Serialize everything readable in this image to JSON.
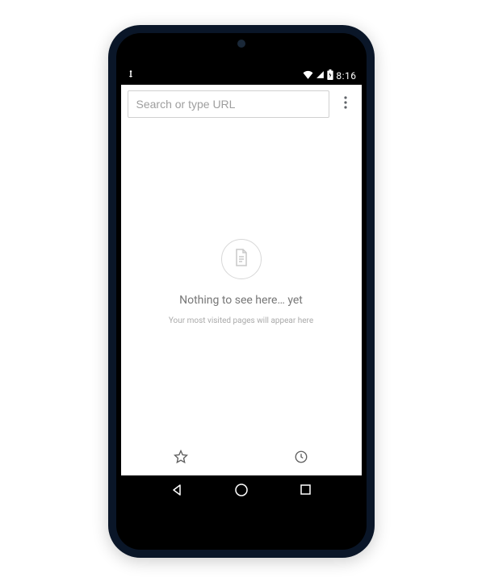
{
  "status_bar": {
    "time": "8:16"
  },
  "toolbar": {
    "url_placeholder": "Search or type URL"
  },
  "empty_state": {
    "title": "Nothing to see here… yet",
    "subtitle": "Your most visited pages will appear here"
  }
}
